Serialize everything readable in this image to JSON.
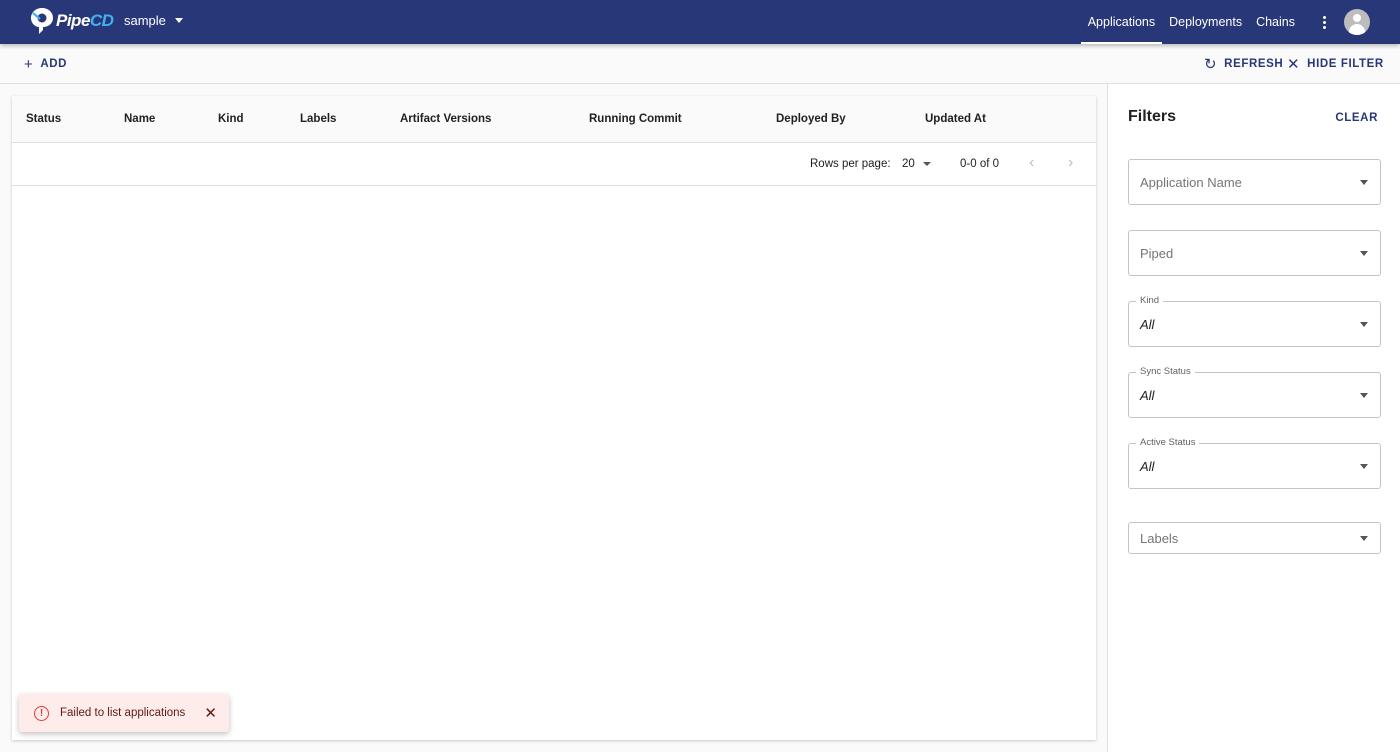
{
  "appbar": {
    "logo_main": "Pipe",
    "logo_accent": "CD",
    "project": "sample",
    "nav": [
      "Applications",
      "Deployments",
      "Chains"
    ],
    "active_nav": "Applications",
    "brand_color": "#283778"
  },
  "toolbar": {
    "add_label": "ADD",
    "refresh_label": "REFRESH",
    "hide_filter_label": "HIDE FILTER"
  },
  "table": {
    "columns": [
      "Status",
      "Name",
      "Kind",
      "Labels",
      "Artifact Versions",
      "Running Commit",
      "Deployed By",
      "Updated At"
    ],
    "rows": [],
    "rows_per_page_label": "Rows per page:",
    "rows_per_page": "20",
    "range": "0-0 of 0"
  },
  "filters": {
    "title": "Filters",
    "clear_label": "CLEAR",
    "application_name_placeholder": "Application Name",
    "piped_placeholder": "Piped",
    "kind_label": "Kind",
    "kind_value": "All",
    "sync_status_label": "Sync Status",
    "sync_status_value": "All",
    "active_status_label": "Active Status",
    "active_status_value": "All",
    "labels_placeholder": "Labels"
  },
  "snackbar": {
    "message": "Failed to list applications",
    "severity_color": "#e53935"
  }
}
